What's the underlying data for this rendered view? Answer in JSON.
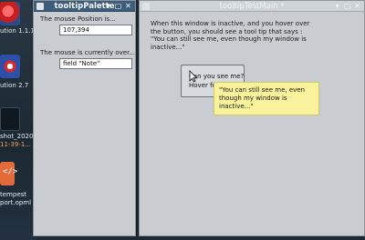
{
  "desktop": {
    "items": [
      {
        "label": "ution 1.1.1"
      },
      {
        "label": "ution 2.7"
      },
      {
        "label": "shot_2020"
      },
      {
        "label": "11-39-1..."
      },
      {
        "label": "tempest"
      },
      {
        "label": "port.opml"
      }
    ]
  },
  "palette": {
    "title": "tooltipPalette",
    "mouse_position_label": "The mouse Position is...",
    "mouse_position_value": "107,394",
    "mouse_over_label": "The mouse is currently over...",
    "mouse_over_value": "field \"Note\""
  },
  "main": {
    "title": "tooltipTestMain *",
    "instructions": "When this window is inactive, and you hover over the button, you should see a tool tip that says : \"You can still see me, even though my window is inactive...\"",
    "button_line1": "Can you see me?",
    "button_line2": "Hover fo",
    "tooltip": "\"You can still see me, even though my window is inactive...\""
  },
  "icons": {
    "close": "close-icon",
    "minimize": "minimize-icon",
    "maximize": "maximize-icon",
    "cursor": "mouse-pointer-icon"
  }
}
